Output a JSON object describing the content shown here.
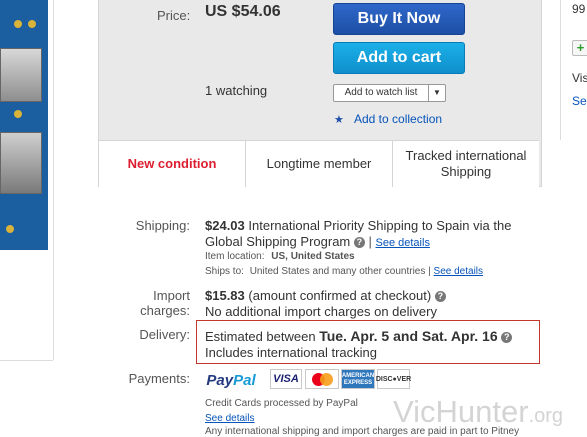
{
  "listing": {
    "price_label": "Price:",
    "price": "US $54.06",
    "buy_now": "Buy It Now",
    "add_to_cart": "Add to cart",
    "watching": "1 watching",
    "add_to_watch_list": "Add to watch list",
    "add_to_collection": "Add to collection"
  },
  "badges": {
    "condition": "New condition",
    "member": "Longtime member",
    "shipping": "Tracked international Shipping"
  },
  "right_column": {
    "t1": "99",
    "t2": "Vis",
    "t3": "Se"
  },
  "shipping": {
    "label": "Shipping:",
    "cost": "$24.03",
    "service": "International Priority Shipping to Spain  via the",
    "service_line2": "Global Shipping Program",
    "see_details": "See details",
    "item_location_label": "Item location:",
    "item_location": "US, United States",
    "ships_to_label": "Ships to:",
    "ships_to": "United States and many other countries",
    "ships_to_details": "See details"
  },
  "import": {
    "label": "Import charges:",
    "cost": "$15.83",
    "note": "(amount confirmed at checkout)",
    "line2": "No additional import charges on delivery"
  },
  "delivery": {
    "label": "Delivery:",
    "prefix": "Estimated between",
    "dates": "Tue. Apr. 5 and Sat. Apr. 16",
    "tracking": "Includes international tracking"
  },
  "payments": {
    "label": "Payments:",
    "paypal_a": "Pay",
    "paypal_b": "Pal",
    "visa": "VISA",
    "amex": "AMERICAN EXPRESS",
    "discover": "DISC●VER",
    "credit_note": "Credit Cards processed by PayPal",
    "see_details": "See details",
    "bottom_note": "Any international shipping and import charges are paid in part to Pitney"
  },
  "watermark": {
    "vic": "Vic",
    "hunter": "Hunter",
    "org": ".org"
  },
  "colors": {
    "buy_now": "#1d4fa6",
    "add_to_cart": "#0f8fcc",
    "link": "#0654ba",
    "condition_red": "#dd1e31",
    "delivery_border": "#c0392b"
  },
  "icons": [
    "star-icon",
    "help-icon",
    "chevron-down-icon",
    "plus-icon"
  ]
}
